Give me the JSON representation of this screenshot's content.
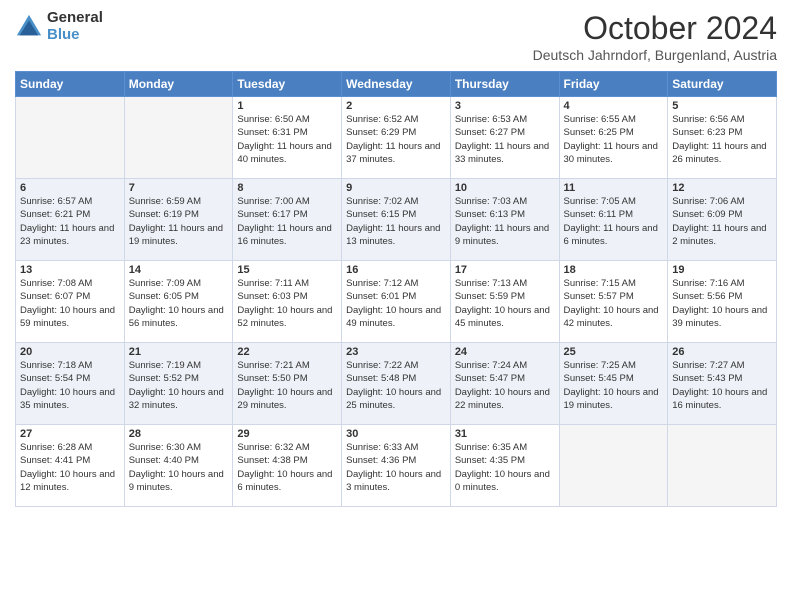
{
  "header": {
    "logo": {
      "general": "General",
      "blue": "Blue"
    },
    "title": "October 2024",
    "subtitle": "Deutsch Jahrndorf, Burgenland, Austria"
  },
  "days_of_week": [
    "Sunday",
    "Monday",
    "Tuesday",
    "Wednesday",
    "Thursday",
    "Friday",
    "Saturday"
  ],
  "weeks": [
    [
      {
        "day": "",
        "sunrise": "",
        "sunset": "",
        "daylight": ""
      },
      {
        "day": "",
        "sunrise": "",
        "sunset": "",
        "daylight": ""
      },
      {
        "day": "1",
        "sunrise": "Sunrise: 6:50 AM",
        "sunset": "Sunset: 6:31 PM",
        "daylight": "Daylight: 11 hours and 40 minutes."
      },
      {
        "day": "2",
        "sunrise": "Sunrise: 6:52 AM",
        "sunset": "Sunset: 6:29 PM",
        "daylight": "Daylight: 11 hours and 37 minutes."
      },
      {
        "day": "3",
        "sunrise": "Sunrise: 6:53 AM",
        "sunset": "Sunset: 6:27 PM",
        "daylight": "Daylight: 11 hours and 33 minutes."
      },
      {
        "day": "4",
        "sunrise": "Sunrise: 6:55 AM",
        "sunset": "Sunset: 6:25 PM",
        "daylight": "Daylight: 11 hours and 30 minutes."
      },
      {
        "day": "5",
        "sunrise": "Sunrise: 6:56 AM",
        "sunset": "Sunset: 6:23 PM",
        "daylight": "Daylight: 11 hours and 26 minutes."
      }
    ],
    [
      {
        "day": "6",
        "sunrise": "Sunrise: 6:57 AM",
        "sunset": "Sunset: 6:21 PM",
        "daylight": "Daylight: 11 hours and 23 minutes."
      },
      {
        "day": "7",
        "sunrise": "Sunrise: 6:59 AM",
        "sunset": "Sunset: 6:19 PM",
        "daylight": "Daylight: 11 hours and 19 minutes."
      },
      {
        "day": "8",
        "sunrise": "Sunrise: 7:00 AM",
        "sunset": "Sunset: 6:17 PM",
        "daylight": "Daylight: 11 hours and 16 minutes."
      },
      {
        "day": "9",
        "sunrise": "Sunrise: 7:02 AM",
        "sunset": "Sunset: 6:15 PM",
        "daylight": "Daylight: 11 hours and 13 minutes."
      },
      {
        "day": "10",
        "sunrise": "Sunrise: 7:03 AM",
        "sunset": "Sunset: 6:13 PM",
        "daylight": "Daylight: 11 hours and 9 minutes."
      },
      {
        "day": "11",
        "sunrise": "Sunrise: 7:05 AM",
        "sunset": "Sunset: 6:11 PM",
        "daylight": "Daylight: 11 hours and 6 minutes."
      },
      {
        "day": "12",
        "sunrise": "Sunrise: 7:06 AM",
        "sunset": "Sunset: 6:09 PM",
        "daylight": "Daylight: 11 hours and 2 minutes."
      }
    ],
    [
      {
        "day": "13",
        "sunrise": "Sunrise: 7:08 AM",
        "sunset": "Sunset: 6:07 PM",
        "daylight": "Daylight: 10 hours and 59 minutes."
      },
      {
        "day": "14",
        "sunrise": "Sunrise: 7:09 AM",
        "sunset": "Sunset: 6:05 PM",
        "daylight": "Daylight: 10 hours and 56 minutes."
      },
      {
        "day": "15",
        "sunrise": "Sunrise: 7:11 AM",
        "sunset": "Sunset: 6:03 PM",
        "daylight": "Daylight: 10 hours and 52 minutes."
      },
      {
        "day": "16",
        "sunrise": "Sunrise: 7:12 AM",
        "sunset": "Sunset: 6:01 PM",
        "daylight": "Daylight: 10 hours and 49 minutes."
      },
      {
        "day": "17",
        "sunrise": "Sunrise: 7:13 AM",
        "sunset": "Sunset: 5:59 PM",
        "daylight": "Daylight: 10 hours and 45 minutes."
      },
      {
        "day": "18",
        "sunrise": "Sunrise: 7:15 AM",
        "sunset": "Sunset: 5:57 PM",
        "daylight": "Daylight: 10 hours and 42 minutes."
      },
      {
        "day": "19",
        "sunrise": "Sunrise: 7:16 AM",
        "sunset": "Sunset: 5:56 PM",
        "daylight": "Daylight: 10 hours and 39 minutes."
      }
    ],
    [
      {
        "day": "20",
        "sunrise": "Sunrise: 7:18 AM",
        "sunset": "Sunset: 5:54 PM",
        "daylight": "Daylight: 10 hours and 35 minutes."
      },
      {
        "day": "21",
        "sunrise": "Sunrise: 7:19 AM",
        "sunset": "Sunset: 5:52 PM",
        "daylight": "Daylight: 10 hours and 32 minutes."
      },
      {
        "day": "22",
        "sunrise": "Sunrise: 7:21 AM",
        "sunset": "Sunset: 5:50 PM",
        "daylight": "Daylight: 10 hours and 29 minutes."
      },
      {
        "day": "23",
        "sunrise": "Sunrise: 7:22 AM",
        "sunset": "Sunset: 5:48 PM",
        "daylight": "Daylight: 10 hours and 25 minutes."
      },
      {
        "day": "24",
        "sunrise": "Sunrise: 7:24 AM",
        "sunset": "Sunset: 5:47 PM",
        "daylight": "Daylight: 10 hours and 22 minutes."
      },
      {
        "day": "25",
        "sunrise": "Sunrise: 7:25 AM",
        "sunset": "Sunset: 5:45 PM",
        "daylight": "Daylight: 10 hours and 19 minutes."
      },
      {
        "day": "26",
        "sunrise": "Sunrise: 7:27 AM",
        "sunset": "Sunset: 5:43 PM",
        "daylight": "Daylight: 10 hours and 16 minutes."
      }
    ],
    [
      {
        "day": "27",
        "sunrise": "Sunrise: 6:28 AM",
        "sunset": "Sunset: 4:41 PM",
        "daylight": "Daylight: 10 hours and 12 minutes."
      },
      {
        "day": "28",
        "sunrise": "Sunrise: 6:30 AM",
        "sunset": "Sunset: 4:40 PM",
        "daylight": "Daylight: 10 hours and 9 minutes."
      },
      {
        "day": "29",
        "sunrise": "Sunrise: 6:32 AM",
        "sunset": "Sunset: 4:38 PM",
        "daylight": "Daylight: 10 hours and 6 minutes."
      },
      {
        "day": "30",
        "sunrise": "Sunrise: 6:33 AM",
        "sunset": "Sunset: 4:36 PM",
        "daylight": "Daylight: 10 hours and 3 minutes."
      },
      {
        "day": "31",
        "sunrise": "Sunrise: 6:35 AM",
        "sunset": "Sunset: 4:35 PM",
        "daylight": "Daylight: 10 hours and 0 minutes."
      },
      {
        "day": "",
        "sunrise": "",
        "sunset": "",
        "daylight": ""
      },
      {
        "day": "",
        "sunrise": "",
        "sunset": "",
        "daylight": ""
      }
    ]
  ]
}
